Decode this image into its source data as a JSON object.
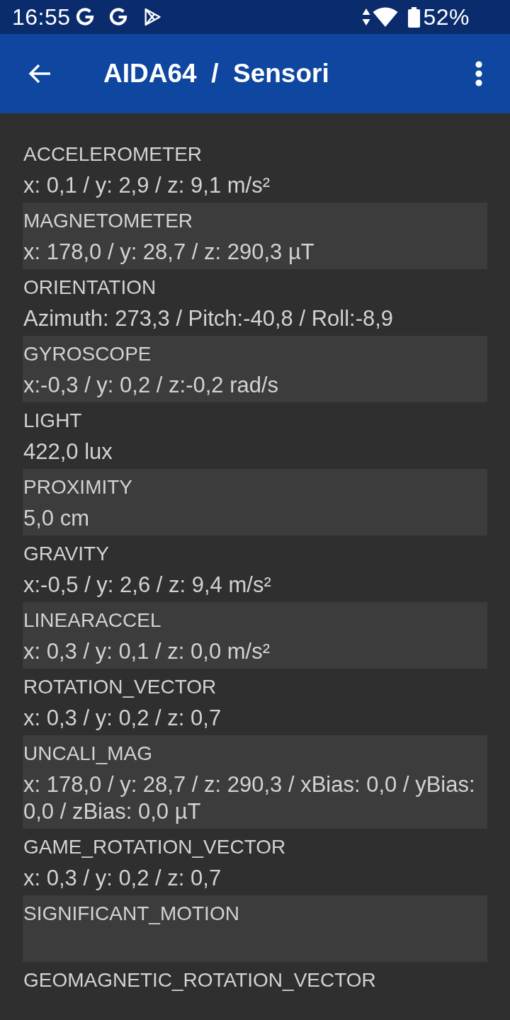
{
  "status_bar": {
    "time": "16:55",
    "battery": "52%"
  },
  "app_bar": {
    "title": "AIDA64  /  Sensori"
  },
  "sensors": [
    {
      "name": "ACCELEROMETER",
      "value": "x: 0,1 / y: 2,9 / z: 9,1 m/s²"
    },
    {
      "name": "MAGNETOMETER",
      "value": "x: 178,0 / y: 28,7 / z: 290,3 µT"
    },
    {
      "name": "ORIENTATION",
      "value": "Azimuth: 273,3 / Pitch:-40,8 / Roll:-8,9"
    },
    {
      "name": "GYROSCOPE",
      "value": "x:-0,3 / y: 0,2 / z:-0,2 rad/s"
    },
    {
      "name": "LIGHT",
      "value": "422,0 lux"
    },
    {
      "name": "PROXIMITY",
      "value": "5,0 cm"
    },
    {
      "name": "GRAVITY",
      "value": "x:-0,5 / y: 2,6 / z: 9,4 m/s²"
    },
    {
      "name": "LINEARACCEL",
      "value": "x: 0,3 / y: 0,1 / z: 0,0 m/s²"
    },
    {
      "name": "ROTATION_VECTOR",
      "value": "x: 0,3 / y: 0,2 / z: 0,7"
    },
    {
      "name": "UNCALI_MAG",
      "value": "x: 178,0 / y: 28,7 / z: 290,3 / xBias: 0,0 / yBias: 0,0 / zBias: 0,0 µT"
    },
    {
      "name": "GAME_ROTATION_VECTOR",
      "value": "x: 0,3 / y: 0,2 / z: 0,7"
    },
    {
      "name": "SIGNIFICANT_MOTION"
    },
    {
      "name": "GEOMAGNETIC_ROTATION_VECTOR"
    }
  ]
}
